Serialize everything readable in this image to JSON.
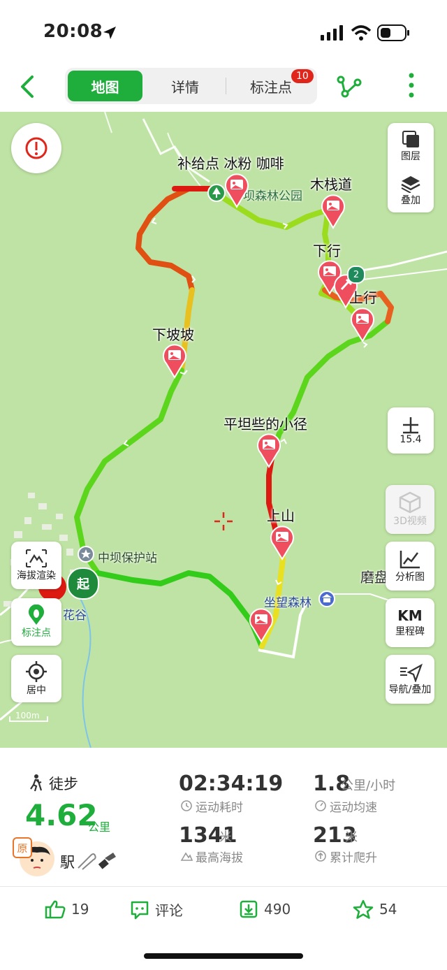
{
  "status": {
    "time": "20:08"
  },
  "tabs": [
    {
      "label": "地图",
      "active": true
    },
    {
      "label": "详情",
      "active": false
    },
    {
      "label": "标注点",
      "active": false,
      "badge": "10"
    }
  ],
  "map": {
    "pins": [
      {
        "label": "补给点 冰粉 咖啡"
      },
      {
        "label": "木栈道"
      },
      {
        "label": "下行"
      },
      {
        "label": "上行"
      },
      {
        "label": "下坡坡"
      },
      {
        "label": "平坦些的小径"
      },
      {
        "label": "上山"
      }
    ],
    "pois": {
      "park": "坝森林公园",
      "station": "中坝保护站",
      "forest": "坐望森林",
      "flower": "花谷",
      "mopan": "磨盘"
    },
    "cluster_count": "2",
    "start_label": "起",
    "scale": "100m",
    "zoom": "15.4",
    "right_buttons": [
      {
        "label": "图层"
      },
      {
        "label": "叠加"
      },
      {
        "label": "3D视频"
      },
      {
        "label": "分析图"
      },
      {
        "icon_text": "KM",
        "label": "里程碑"
      },
      {
        "label": "导航/叠加"
      }
    ],
    "left_buttons": [
      {
        "label": "海拔渲染"
      },
      {
        "label": "标注点"
      },
      {
        "label": "居中"
      }
    ],
    "route_colors": {
      "low": "#33cc1a",
      "mid": "#e8e020",
      "high": "#dd1a12"
    }
  },
  "summary": {
    "activity": "徒步",
    "distance": "4.62",
    "distance_unit": "公里",
    "duration": "02:34:19",
    "duration_label": "运动耗时",
    "speed": "1.8",
    "speed_unit": "公里/小时",
    "speed_label": "运动均速",
    "max_alt": "1341",
    "max_alt_unit": "米",
    "max_alt_label": "最高海拔",
    "climb": "213",
    "climb_unit": "米",
    "climb_label": "累计爬升",
    "username": "駅",
    "avatar_badge": "原"
  },
  "actions": {
    "likes": "19",
    "comment": "评论",
    "downloads": "490",
    "stars": "54"
  }
}
